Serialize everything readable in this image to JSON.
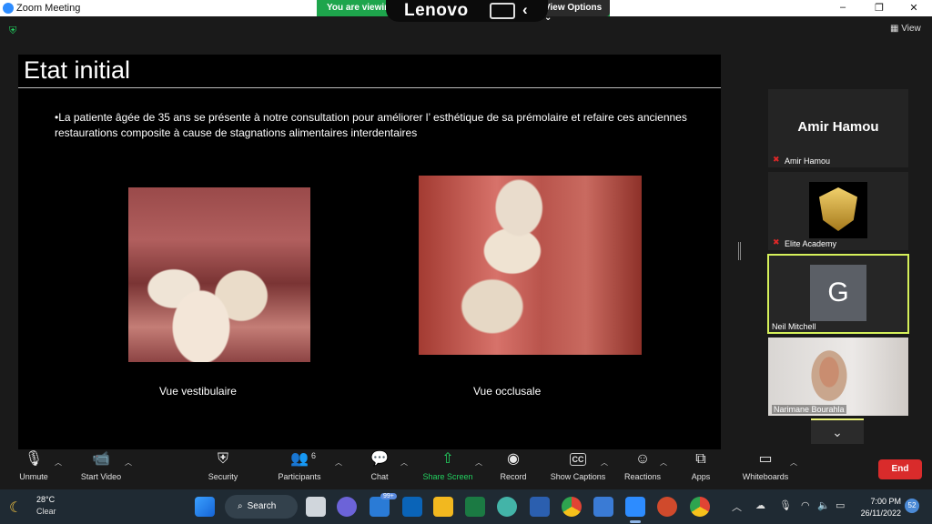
{
  "window": {
    "title": "Zoom Meeting",
    "minimize": "–",
    "restore": "❐",
    "close": "✕"
  },
  "share_banner": {
    "text": "You are viewin",
    "view_options": "View Options ⌄"
  },
  "device_bar": {
    "brand": "Lenovo",
    "back": "‹"
  },
  "meeting": {
    "view_label": "View"
  },
  "slide": {
    "title": "Etat initial",
    "bullet": "•La patiente âgée de 35 ans se présente à notre consultation pour améliorer l’ esthétique de sa prémolaire et refaire ces anciennes restaurations composite à cause de stagnations alimentaires interdentaires",
    "caption_left": "Vue vestibulaire",
    "caption_right": "Vue occlusale"
  },
  "participants": [
    {
      "name": "Amir Hamou",
      "display": "Amir Hamou",
      "muted": true
    },
    {
      "name": "Elite Academy",
      "muted": true
    },
    {
      "name": "Neil Mitchell",
      "initial": "G",
      "muted": false,
      "active_speaker": true
    },
    {
      "name": "Narimane Bourahla",
      "muted": false
    }
  ],
  "toolbar": {
    "unmute": "Unmute",
    "start_video": "Start Video",
    "security": "Security",
    "participants": "Participants",
    "participants_count": "6",
    "chat": "Chat",
    "share_screen": "Share Screen",
    "record": "Record",
    "show_captions": "Show Captions",
    "captions_icon": "CC",
    "reactions": "Reactions",
    "apps": "Apps",
    "whiteboards": "Whiteboards",
    "end": "End"
  },
  "taskbar": {
    "temperature": "28°C",
    "condition": "Clear",
    "search": "Search",
    "mail_badge": "99+",
    "time": "7:00 PM",
    "date": "26/11/2022",
    "notifications": "52"
  },
  "colors": {
    "accent_green": "#23d160",
    "active_speaker": "#d5f05a",
    "end_red": "#d92b2b",
    "zoom_blue": "#2d8cff"
  }
}
